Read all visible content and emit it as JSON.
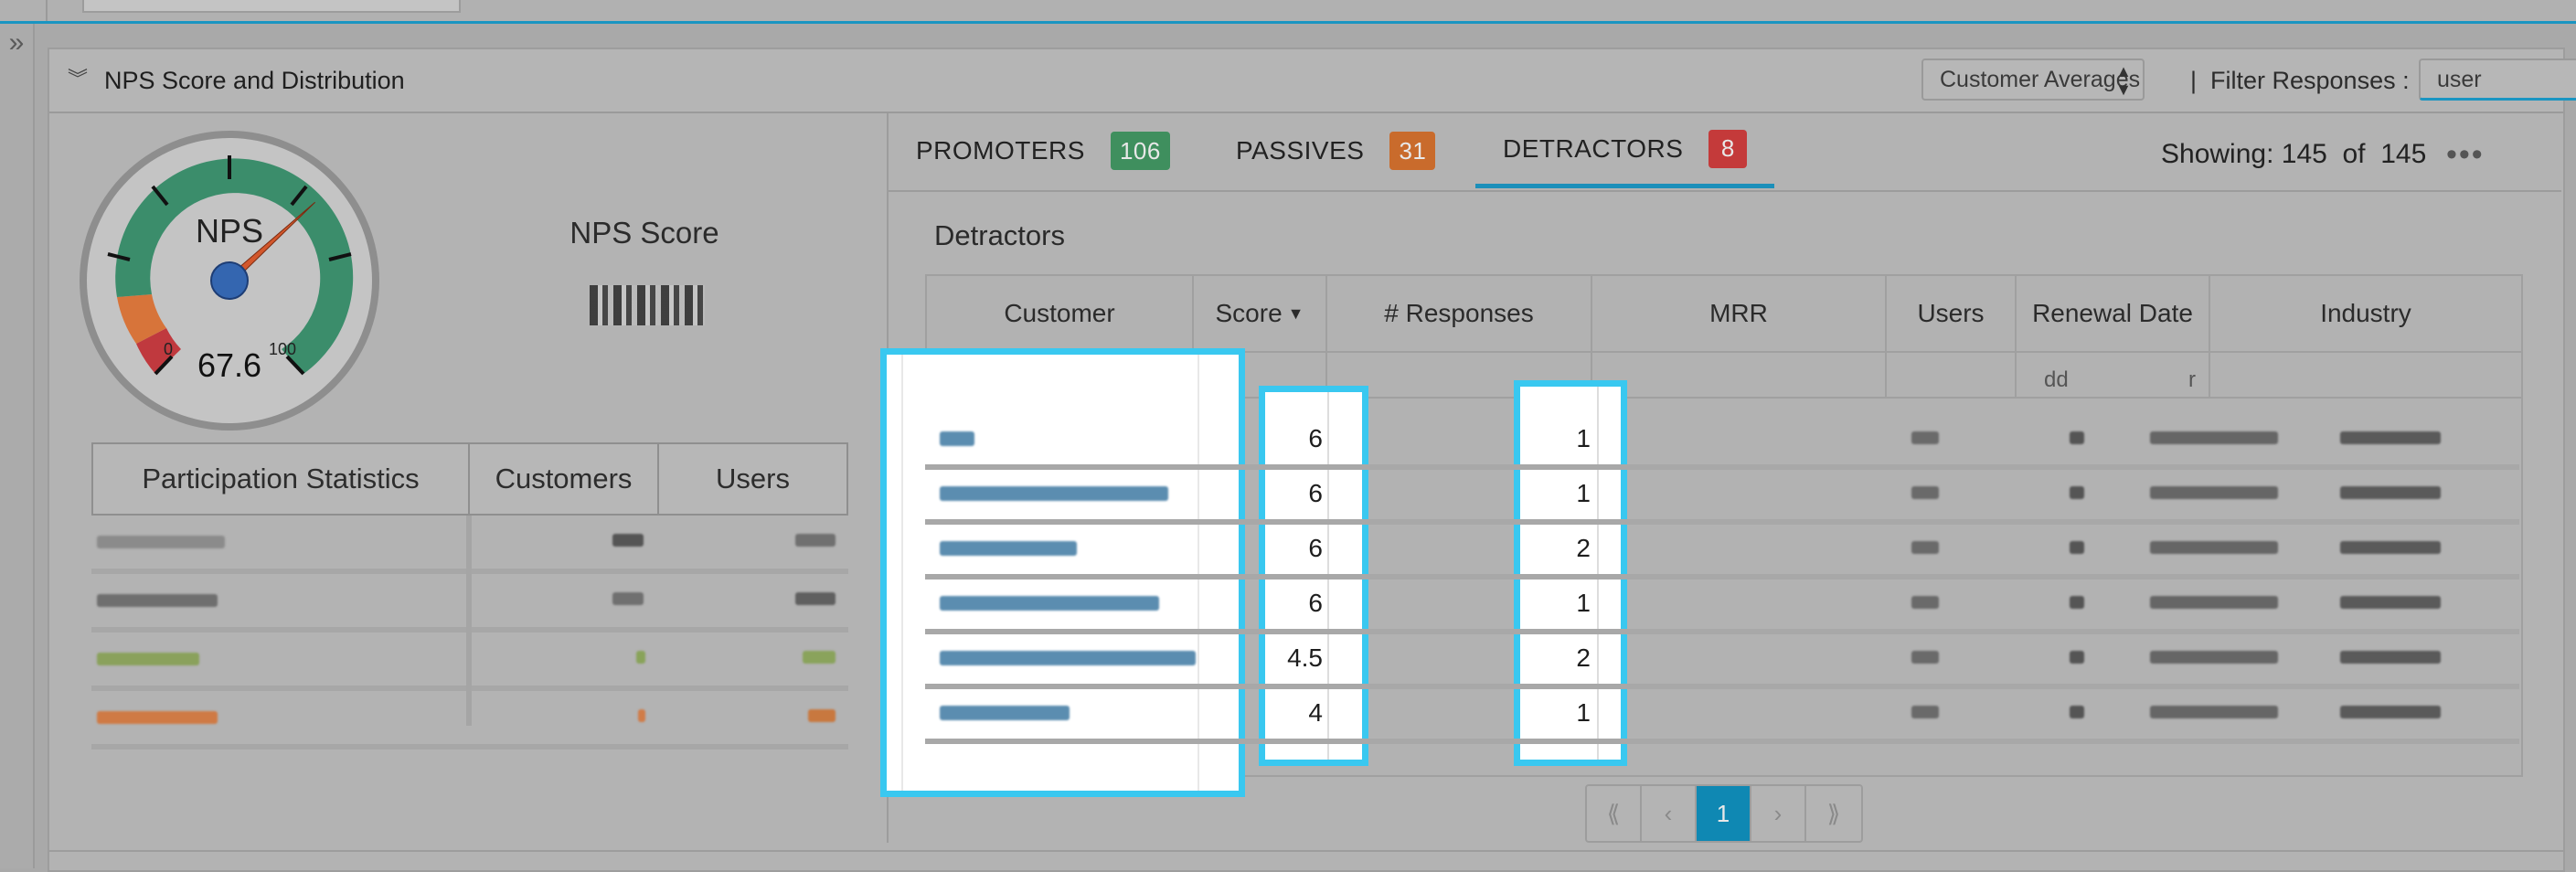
{
  "panel": {
    "title": "NPS Score and Distribution",
    "avg_select": "Customer Averages",
    "pipe": "|",
    "filter_label": "Filter Responses :",
    "filter_select": "user"
  },
  "gauge": {
    "label": "NPS",
    "min": "0",
    "max": "100",
    "value": "67.6",
    "needle_value": 67.6
  },
  "nps_score_label": "NPS Score",
  "participation": {
    "headers": [
      "Participation Statistics",
      "Customers",
      "Users"
    ]
  },
  "tabs": [
    {
      "label": "PROMOTERS",
      "count": "106",
      "color": "#3f8f5e"
    },
    {
      "label": "PASSIVES",
      "count": "31",
      "color": "#c96b2c"
    },
    {
      "label": "DETRACTORS",
      "count": "8",
      "color": "#c43a3a"
    }
  ],
  "showing": {
    "label": "Showing:",
    "count": "145",
    "of": "of",
    "total": "145"
  },
  "section_title": "Detractors",
  "table": {
    "headers": [
      "Customer",
      "Score",
      "# Responses",
      "MRR",
      "Users",
      "Renewal Date",
      "Industry"
    ],
    "filter_renewal": "dd",
    "filter_renewal_suffix": "r",
    "rows": [
      {
        "score": "6",
        "responses": "1"
      },
      {
        "score": "6",
        "responses": "1"
      },
      {
        "score": "6",
        "responses": "2"
      },
      {
        "score": "6",
        "responses": "1"
      },
      {
        "score": "4.5",
        "responses": "2"
      },
      {
        "score": "4",
        "responses": "1"
      }
    ]
  },
  "pager": {
    "first": "⟪",
    "prev": "‹",
    "current": "1",
    "next": "›",
    "last": "⟫"
  },
  "colors": {
    "accent": "#1a95c1",
    "highlight": "#39c8f0"
  }
}
